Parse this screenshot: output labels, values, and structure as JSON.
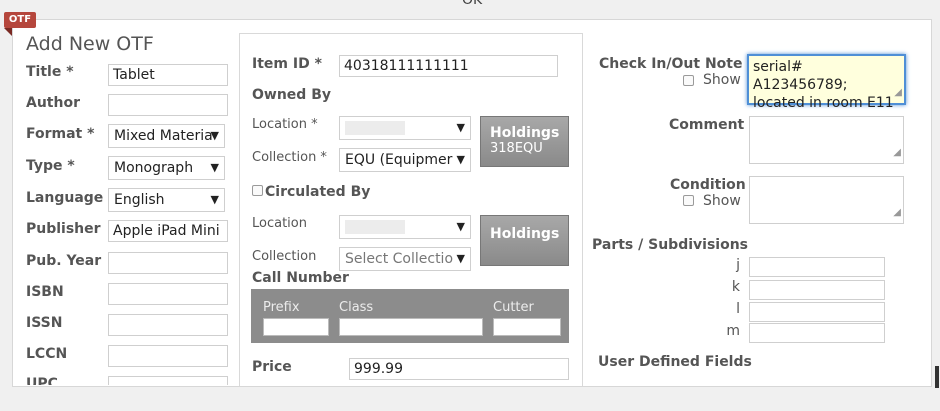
{
  "window": {
    "top_text": "OK"
  },
  "badge": {
    "text": "OTF"
  },
  "dialog": {
    "title": "Add New OTF"
  },
  "left": {
    "title_label": "Title *",
    "title_value": "Tablet",
    "author_label": "Author",
    "author_value": "",
    "format_label": "Format *",
    "format_value": "Mixed Materia",
    "type_label": "Type *",
    "type_value": "Monograph",
    "language_label": "Language",
    "language_value": "English",
    "publisher_label": "Publisher",
    "publisher_value": "Apple iPad Mini",
    "pubyear_label": "Pub. Year",
    "isbn_label": "ISBN",
    "issn_label": "ISSN",
    "lccn_label": "LCCN",
    "upc_label": "UPC"
  },
  "middle": {
    "itemid_label": "Item ID *",
    "itemid_value": "40318111111111",
    "owned_by": "Owned By",
    "location_label": "Location *",
    "collection_label": "Collection *",
    "collection_value": "EQU (Equipmer",
    "holdings1_label": "Holdings",
    "holdings1_sub": "318EQU",
    "circulated_by": "Circulated By",
    "location2_label": "Location",
    "collection2_label": "Collection",
    "collection2_value": "Select Collectio",
    "holdings2_label": "Holdings",
    "call_number": "Call Number",
    "prefix": "Prefix",
    "class": "Class",
    "cutter": "Cutter",
    "price_label": "Price",
    "price_value": "999.99"
  },
  "right": {
    "checkinout_label": "Check In/Out Note",
    "show_label": "Show",
    "note_line1": "serial# A123456789;",
    "note_line2": "located in room E11",
    "comment_label": "Comment",
    "condition_label": "Condition",
    "show2_label": "Show",
    "parts_label": "Parts / Subdivisions",
    "part_j": "j",
    "part_k": "k",
    "part_l": "l",
    "part_m": "m",
    "udf_label": "User Defined Fields"
  },
  "icons": {
    "dropdown": "caret-down-icon",
    "resize": "resize-grip-icon"
  }
}
